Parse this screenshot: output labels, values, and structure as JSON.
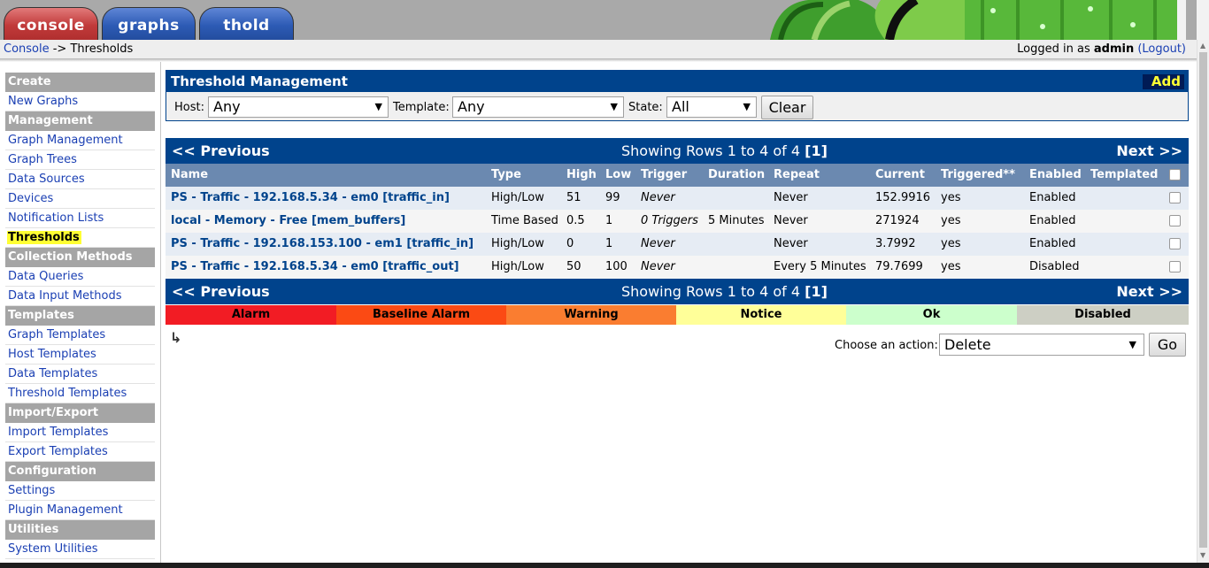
{
  "tabs": {
    "console": "console",
    "graphs": "graphs",
    "thold": "thold"
  },
  "breadcrumb": {
    "link": "Console",
    "sep": " -> ",
    "current": "Thresholds"
  },
  "login": {
    "prefix": "Logged in as ",
    "user": "admin",
    "logout": "(Logout)"
  },
  "sidebar": {
    "create": "Create",
    "new_graphs": "New Graphs",
    "management": "Management",
    "graph_management": "Graph Management",
    "graph_trees": "Graph Trees",
    "data_sources": "Data Sources",
    "devices": "Devices",
    "notification_lists": "Notification Lists",
    "thresholds": "Thresholds",
    "collection_methods": "Collection Methods",
    "data_queries": "Data Queries",
    "data_input_methods": "Data Input Methods",
    "templates": "Templates",
    "graph_templates": "Graph Templates",
    "host_templates": "Host Templates",
    "data_templates": "Data Templates",
    "threshold_templates": "Threshold Templates",
    "import_export": "Import/Export",
    "import_templates": "Import Templates",
    "export_templates": "Export Templates",
    "configuration": "Configuration",
    "settings": "Settings",
    "plugin_management": "Plugin Management",
    "utilities": "Utilities",
    "system_utilities": "System Utilities"
  },
  "filter": {
    "title": "Threshold Management",
    "add": "Add",
    "host_label": "Host:",
    "host_value": "Any",
    "template_label": "Template:",
    "template_value": "Any",
    "state_label": "State:",
    "state_value": "All",
    "clear": "Clear"
  },
  "nav": {
    "previous": "<< Previous",
    "next": "Next >>",
    "showing": "Showing Rows 1 to 4 of 4 ",
    "page": "[1]"
  },
  "columns": {
    "name": "Name",
    "type": "Type",
    "high": "High",
    "low": "Low",
    "trigger": "Trigger",
    "duration": "Duration",
    "repeat": "Repeat",
    "current": "Current",
    "triggered": "Triggered**",
    "enabled": "Enabled",
    "templated": "Templated"
  },
  "rows": [
    {
      "name": "PS - Traffic - 192.168.5.34 - em0 [traffic_in]",
      "type": "High/Low",
      "high": "51",
      "low": "99",
      "trigger": "Never",
      "duration": "",
      "repeat": "Never",
      "current": "152.9916",
      "triggered": "yes",
      "enabled": "Enabled",
      "templated": ""
    },
    {
      "name": "local - Memory - Free [mem_buffers]",
      "type": "Time Based",
      "high": "0.5",
      "low": "1",
      "trigger": "0 Triggers",
      "duration": "5 Minutes",
      "repeat": "Never",
      "current": "271924",
      "triggered": "yes",
      "enabled": "Enabled",
      "templated": ""
    },
    {
      "name": "PS - Traffic - 192.168.153.100 - em1 [traffic_in]",
      "type": "High/Low",
      "high": "0",
      "low": "1",
      "trigger": "Never",
      "duration": "",
      "repeat": "Never",
      "current": "3.7992",
      "triggered": "yes",
      "enabled": "Enabled",
      "templated": ""
    },
    {
      "name": "PS - Traffic - 192.168.5.34 - em0 [traffic_out]",
      "type": "High/Low",
      "high": "50",
      "low": "100",
      "trigger": "Never",
      "duration": "",
      "repeat": "Every 5 Minutes",
      "current": "79.7699",
      "triggered": "yes",
      "enabled": "Disabled",
      "templated": ""
    }
  ],
  "legend": [
    {
      "label": "Alarm",
      "color": "#f21c24"
    },
    {
      "label": "Baseline Alarm",
      "color": "#fb4a14"
    },
    {
      "label": "Warning",
      "color": "#fa7d30"
    },
    {
      "label": "Notice",
      "color": "#ffff99"
    },
    {
      "label": "Ok",
      "color": "#ccffcc"
    },
    {
      "label": "Disabled",
      "color": "#cdcfc4"
    }
  ],
  "action": {
    "label": "Choose an action:",
    "value": "Delete",
    "go": "Go"
  },
  "colors": {
    "header_blue": "#00438c",
    "column_header": "#6b89b0",
    "sidebar_head": "#a5a5a5",
    "highlight": "#ffff33"
  }
}
